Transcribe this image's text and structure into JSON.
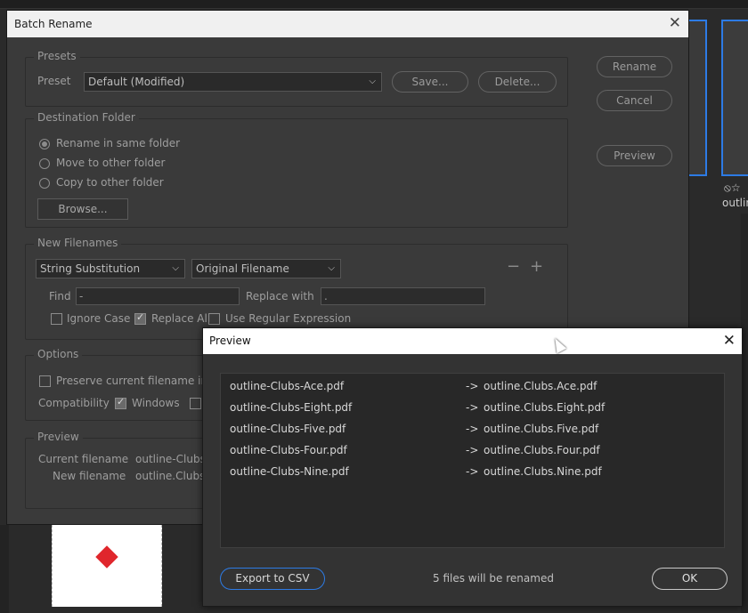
{
  "background": {
    "side_icons": "⦸☆",
    "side_label": "outlin",
    "right_partial": "n"
  },
  "batch_rename": {
    "title": "Batch Rename",
    "buttons": {
      "rename": "Rename",
      "cancel": "Cancel",
      "preview": "Preview"
    },
    "presets": {
      "group_title": "Presets",
      "preset_label": "Preset",
      "preset_value": "Default (Modified)",
      "save": "Save...",
      "delete": "Delete..."
    },
    "destination": {
      "group_title": "Destination Folder",
      "options": [
        "Rename in same folder",
        "Move to other folder",
        "Copy to other folder"
      ],
      "selected_index": 0,
      "browse": "Browse..."
    },
    "new_filenames": {
      "group_title": "New Filenames",
      "type_select": "String Substitution",
      "source_select": "Original Filename",
      "find_label": "Find",
      "find_value": "-",
      "replace_label": "Replace with",
      "replace_value": ".",
      "ignore_case": "Ignore Case",
      "replace_all": "Replace All",
      "use_regex": "Use Regular Expression"
    },
    "options": {
      "group_title": "Options",
      "preserve": "Preserve current filename in X",
      "compat_label": "Compatibility",
      "windows": "Windows"
    },
    "preview_group": {
      "group_title": "Preview",
      "current_label": "Current filename",
      "current_value": "outline-Clubs-A",
      "new_label": "New filename",
      "new_value": "outline.Clubs.A"
    }
  },
  "preview_dialog": {
    "title": "Preview",
    "rows": [
      {
        "src": "outline-Clubs-Ace.pdf",
        "arrow": "->",
        "dst": "outline.Clubs.Ace.pdf"
      },
      {
        "src": "outline-Clubs-Eight.pdf",
        "arrow": "->",
        "dst": "outline.Clubs.Eight.pdf"
      },
      {
        "src": "outline-Clubs-Five.pdf",
        "arrow": "->",
        "dst": "outline.Clubs.Five.pdf"
      },
      {
        "src": "outline-Clubs-Four.pdf",
        "arrow": "->",
        "dst": "outline.Clubs.Four.pdf"
      },
      {
        "src": "outline-Clubs-Nine.pdf",
        "arrow": "->",
        "dst": "outline.Clubs.Nine.pdf"
      }
    ],
    "export": "Export to CSV",
    "status": "5 files will be renamed",
    "ok": "OK"
  },
  "colors": {
    "accent": "#2d7be5",
    "dialog_bg": "#3a3a3a",
    "diamond": "#e0262c"
  }
}
